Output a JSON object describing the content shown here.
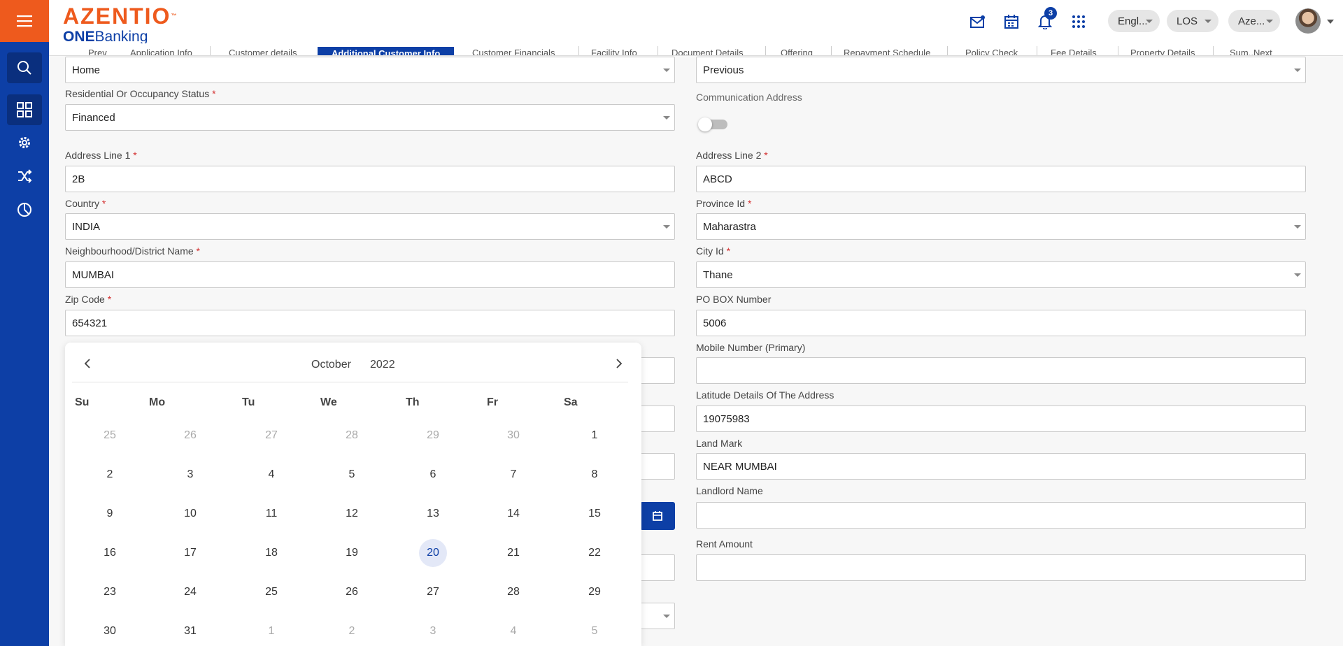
{
  "header": {
    "logo_main": "AZENTIO",
    "logo_tm": "™",
    "logo_sub_bold": "ONE",
    "logo_sub_rest": "Banking",
    "notification_count": "3",
    "language": "Engl...",
    "module": "LOS",
    "entity": "Aze..."
  },
  "sidebar": {
    "items": [
      "menu-icon",
      "search-icon",
      "dashboard-icon",
      "settings-icon",
      "shuffle-icon",
      "pie-chart-icon"
    ]
  },
  "tabs": [
    "Prev",
    "Application Info",
    "Customer details",
    "Additional Customer Info",
    "Customer Financials",
    "Facility Info",
    "Document Details",
    "Offering",
    "Repayment Schedule",
    "Policy Check",
    "Fee Details",
    "Property Details",
    "Sum..",
    "Next"
  ],
  "form": {
    "address_type": "Home",
    "address_period": "Previous",
    "residential_label": "Residential Or Occupancy Status",
    "residential_value": "Financed",
    "communication_label": "Communication Address",
    "address1_label": "Address Line 1",
    "address1_value": "2B",
    "address2_label": "Address Line 2",
    "address2_value": "ABCD",
    "country_label": "Country",
    "country_value": "INDIA",
    "province_label": "Province Id",
    "province_value": "Maharastra",
    "district_label": "Neighbourhood/District Name",
    "district_value": "MUMBAI",
    "city_label": "City Id",
    "city_value": "Thane",
    "zip_label": "Zip Code",
    "zip_value": "654321",
    "pobox_label": "PO BOX Number",
    "pobox_value": "5006",
    "mobile_label": "Mobile Number (Primary)",
    "mobile_value": "",
    "latitude_label": "Latitude Details Of The Address",
    "latitude_value": "19075983",
    "landmark_label": "Land Mark",
    "landmark_value": "NEAR MUMBAI",
    "landlord_label": "Landlord Name",
    "landlord_value": "",
    "rent_label": "Rent Amount",
    "rent_value": ""
  },
  "datepicker": {
    "month": "October",
    "year": "2022",
    "weekdays": [
      "Su",
      "Mo",
      "Tu",
      "We",
      "Th",
      "Fr",
      "Sa"
    ],
    "weeks": [
      [
        "25",
        "26",
        "27",
        "28",
        "29",
        "30",
        "1"
      ],
      [
        "2",
        "3",
        "4",
        "5",
        "6",
        "7",
        "8"
      ],
      [
        "9",
        "10",
        "11",
        "12",
        "13",
        "14",
        "15"
      ],
      [
        "16",
        "17",
        "18",
        "19",
        "20",
        "21",
        "22"
      ],
      [
        "23",
        "24",
        "25",
        "26",
        "27",
        "28",
        "29"
      ],
      [
        "30",
        "31",
        "1",
        "2",
        "3",
        "4",
        "5"
      ]
    ],
    "selected": "20"
  },
  "colors": {
    "brand_orange": "#ee5a1d",
    "brand_blue": "#0d3fa6",
    "required": "#d32f2f"
  }
}
